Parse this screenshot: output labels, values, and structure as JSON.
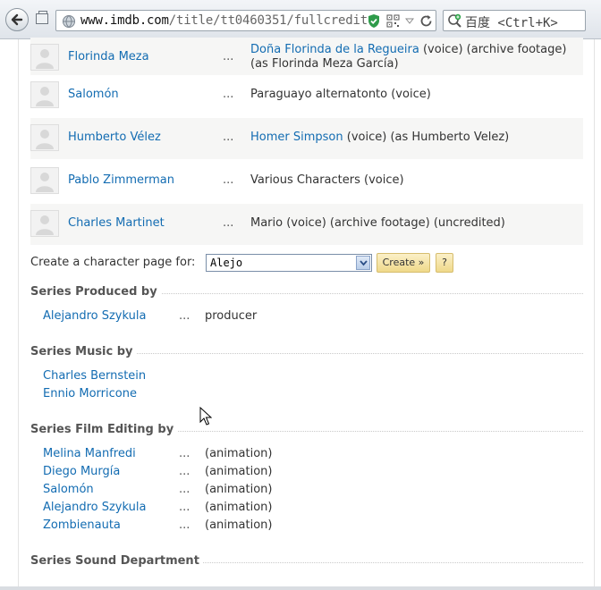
{
  "browser": {
    "url_host": "www.imdb.com",
    "url_path": "/title/tt0460351/fullcredit",
    "search_placeholder": "百度 <Ctrl+K>"
  },
  "cast": [
    {
      "actor": "Florinda Meza",
      "character_link": "Doña Florinda de la Regueira",
      "note": " (voice) (archive footage) (as Florinda Meza García)"
    },
    {
      "actor": "Salomón",
      "character_link": "",
      "note": "Paraguayo alternatonto (voice)"
    },
    {
      "actor": "Humberto Vélez",
      "character_link": "Homer Simpson",
      "note": " (voice) (as Humberto Velez)"
    },
    {
      "actor": "Pablo Zimmerman",
      "character_link": "",
      "note": "Various Characters (voice)"
    },
    {
      "actor": "Charles Martinet",
      "character_link": "",
      "note": "Mario (voice) (archive footage) (uncredited)"
    }
  ],
  "ellipsis": "...",
  "character_page": {
    "label": "Create a character page for:",
    "selected": "Alejo",
    "create_label": "Create »",
    "help_label": "?"
  },
  "sections": {
    "produced": {
      "title": "Series Produced by",
      "rows": [
        {
          "name": "Alejandro Szykula",
          "credit": "producer"
        }
      ]
    },
    "music": {
      "title": "Series Music by",
      "rows": [
        {
          "name": "Charles Bernstein",
          "credit": ""
        },
        {
          "name": "Ennio Morricone",
          "credit": ""
        }
      ]
    },
    "editing": {
      "title": "Series Film Editing by",
      "rows": [
        {
          "name": "Melina Manfredi",
          "credit": "(animation)"
        },
        {
          "name": "Diego Murgía",
          "credit": "(animation)"
        },
        {
          "name": "Salomón",
          "credit": "(animation)"
        },
        {
          "name": "Alejandro Szykula",
          "credit": "(animation)"
        },
        {
          "name": "Zombienauta",
          "credit": "(animation)"
        }
      ]
    },
    "sound": {
      "title": "Series Sound Department"
    }
  },
  "colors": {
    "link": "#136cb2",
    "row_alt": "#f6f6f5"
  }
}
